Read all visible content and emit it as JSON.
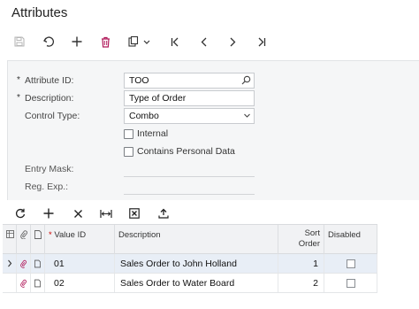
{
  "page": {
    "title": "Attributes"
  },
  "toolbar": {
    "buttons": [
      "save-icon",
      "undo-icon",
      "add-icon",
      "delete-icon",
      "copy-paste-icon",
      "first-record-icon",
      "previous-record-icon",
      "next-record-icon",
      "last-record-icon"
    ]
  },
  "form": {
    "attribute_id": {
      "label": "Attribute ID:",
      "value": "TOO",
      "required": true
    },
    "description": {
      "label": "Description:",
      "value": "Type of Order",
      "required": true
    },
    "control_type": {
      "label": "Control Type:",
      "value": "Combo"
    },
    "internal": {
      "label": "Internal",
      "checked": false
    },
    "contains_personal_data": {
      "label": "Contains Personal Data",
      "checked": false
    },
    "entry_mask": {
      "label": "Entry Mask:",
      "value": ""
    },
    "reg_exp": {
      "label": "Reg. Exp.:",
      "value": ""
    }
  },
  "grid_toolbar": {
    "buttons": [
      "refresh-icon",
      "add-row-icon",
      "delete-row-icon",
      "fit-to-screen-icon",
      "export-excel-icon",
      "upload-icon"
    ]
  },
  "grid": {
    "columns": {
      "value_id": "Value ID",
      "description": "Description",
      "sort_order_line1": "Sort",
      "sort_order_line2": "Order",
      "disabled": "Disabled"
    },
    "rows": [
      {
        "value_id": "01",
        "description": "Sales Order to John Holland",
        "sort_order": "1",
        "disabled": false,
        "selected": true
      },
      {
        "value_id": "02",
        "description": "Sales Order to Water Board",
        "sort_order": "2",
        "disabled": false,
        "selected": false
      }
    ]
  }
}
